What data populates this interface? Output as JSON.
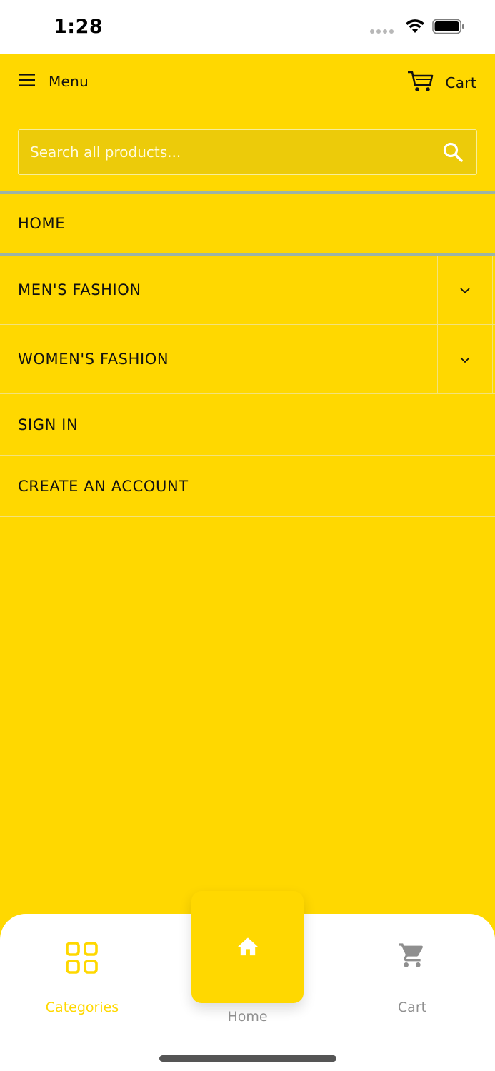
{
  "status_bar": {
    "time": "1:28"
  },
  "header": {
    "menu_label": "Menu",
    "cart_label": "Cart"
  },
  "search": {
    "placeholder": "Search all products..."
  },
  "nav": {
    "home": "HOME",
    "mens_fashion": "MEN'S FASHION",
    "womens_fashion": "WOMEN'S FASHION",
    "sign_in": "SIGN IN",
    "create_account": "CREATE AN ACCOUNT"
  },
  "tabbar": {
    "categories_label": "Categories",
    "home_label": "Home",
    "cart_label": "Cart",
    "active_tab": "Categories"
  },
  "colors": {
    "brand_yellow": "#FFD800",
    "tab_inactive": "#8f8f8f",
    "divider_teal": "#9cb4a5"
  },
  "icons": [
    "menu-icon",
    "cart-icon",
    "search-icon",
    "chevron-down-icon",
    "grid-icon",
    "home-icon",
    "shopping-cart-icon",
    "wifi-icon",
    "battery-icon"
  ]
}
